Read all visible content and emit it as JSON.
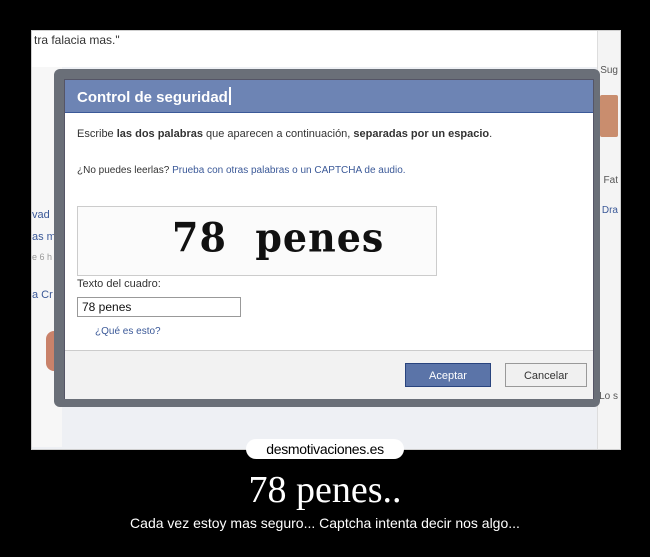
{
  "background": {
    "quote_fragment": "tra falacia mas.\"",
    "left_snippets": [
      "vad",
      "as m",
      "e 6 h",
      "a Cr"
    ],
    "right_snippets": [
      "Sug",
      "Fat",
      "Dra",
      "Lo s"
    ]
  },
  "dialog": {
    "title": "Control de seguridad",
    "instruction_pre": "Escribe ",
    "instruction_bold1": "las dos palabras",
    "instruction_mid": " que aparecen a continuación, ",
    "instruction_bold2": "separadas por un espacio",
    "instruction_end": ".",
    "hint_pre": "¿No puedes leerlas? ",
    "hint_link": "Prueba con otras palabras o un CAPTCHA de audio.",
    "captcha_text": "78  penes",
    "field_label": "Texto del cuadro:",
    "field_value": "78 penes",
    "whatis_link": "¿Qué es esto?",
    "accept_label": "Aceptar",
    "cancel_label": "Cancelar"
  },
  "poster": {
    "site": "desmotivaciones.es",
    "title": "78 penes..",
    "subtitle": "Cada vez estoy mas seguro... Captcha intenta decir nos algo..."
  },
  "colors": {
    "header": "#6d84b4",
    "accept": "#5b74a8",
    "link": "#3b5998"
  }
}
